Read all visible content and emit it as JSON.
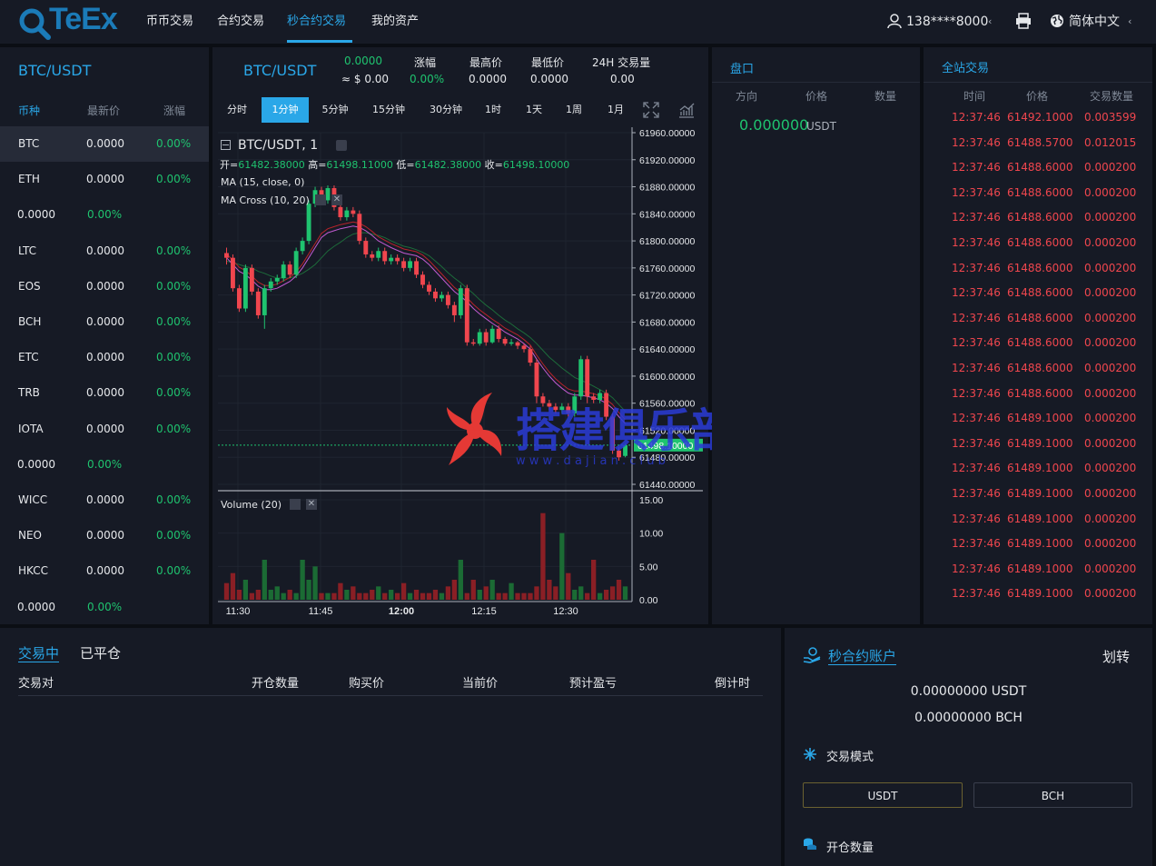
{
  "header": {
    "logo": "TeEx",
    "nav": [
      "币币交易",
      "合约交易",
      "秒合约交易",
      "我的资产"
    ],
    "active_nav": 2,
    "user": "138****8000",
    "language": "简体中文"
  },
  "market": {
    "title": "BTC/USDT",
    "columns": [
      "币种",
      "最新价",
      "涨幅"
    ],
    "rows": [
      {
        "coin": "BTC",
        "price": "0.0000",
        "change": "0.00%"
      },
      {
        "coin": "ETH",
        "price": "0.0000",
        "change": "0.00%"
      },
      {
        "coin": "",
        "price": "0.0000",
        "change": "0.00%"
      },
      {
        "coin": "LTC",
        "price": "0.0000",
        "change": "0.00%"
      },
      {
        "coin": "EOS",
        "price": "0.0000",
        "change": "0.00%"
      },
      {
        "coin": "BCH",
        "price": "0.0000",
        "change": "0.00%"
      },
      {
        "coin": "ETC",
        "price": "0.0000",
        "change": "0.00%"
      },
      {
        "coin": "TRB",
        "price": "0.0000",
        "change": "0.00%"
      },
      {
        "coin": "IOTA",
        "price": "0.0000",
        "change": "0.00%"
      },
      {
        "coin": "",
        "price": "0.0000",
        "change": "0.00%"
      },
      {
        "coin": "WICC",
        "price": "0.0000",
        "change": "0.00%"
      },
      {
        "coin": "NEO",
        "price": "0.0000",
        "change": "0.00%"
      },
      {
        "coin": "HKCC",
        "price": "0.0000",
        "change": "0.00%"
      },
      {
        "coin": "",
        "price": "0.0000",
        "change": "0.00%"
      }
    ]
  },
  "ticker": {
    "pair": "BTC/USDT",
    "last": "0.0000",
    "last_usd": "≈ $ 0.00",
    "change_label": "涨幅",
    "change": "0.00%",
    "high_label": "最高价",
    "high": "0.0000",
    "low_label": "最低价",
    "low": "0.0000",
    "vol_label": "24H 交易量",
    "vol": "0.00"
  },
  "timeframes": [
    "分时",
    "1分钟",
    "5分钟",
    "15分钟",
    "30分钟",
    "1时",
    "1天",
    "1周",
    "1月"
  ],
  "active_timeframe": 1,
  "chart_legend": {
    "symbol": "BTC/USDT, 1",
    "open_label": "开=",
    "open": "61482.38000",
    "high_label": "高=",
    "high": "61498.11000",
    "low_label": "低=",
    "low": "61482.38000",
    "close_label": "收=",
    "close": "61498.10000",
    "ma": "MA (15, close, 0)",
    "macross": "MA Cross (10, 20)",
    "volume": "Volume (20)"
  },
  "chart_data": {
    "type": "candlestick",
    "x_ticks": [
      "11:30",
      "11:45",
      "12:00",
      "12:15",
      "12:30"
    ],
    "price_ticks": [
      "61960.00000",
      "61920.00000",
      "61880.00000",
      "61840.00000",
      "61800.00000",
      "61760.00000",
      "61720.00000",
      "61680.00000",
      "61640.00000",
      "61600.00000",
      "61560.00000",
      "61520.00000",
      "61480.00000",
      "61440.00000"
    ],
    "ylim": [
      61440,
      61960
    ],
    "volume_ticks": [
      "15.00",
      "10.00",
      "5.00",
      "0.00"
    ],
    "volume_ylim": [
      0,
      15
    ],
    "last_price_label": "61498.10000",
    "candles": [
      [
        61782,
        61775,
        61790,
        61765
      ],
      [
        61775,
        61730,
        61780,
        61725
      ],
      [
        61730,
        61700,
        61735,
        61695
      ],
      [
        61700,
        61760,
        61765,
        61695
      ],
      [
        61760,
        61725,
        61765,
        61720
      ],
      [
        61725,
        61690,
        61730,
        61685
      ],
      [
        61690,
        61730,
        61735,
        61670
      ],
      [
        61730,
        61740,
        61745,
        61725
      ],
      [
        61740,
        61745,
        61750,
        61735
      ],
      [
        61745,
        61765,
        61770,
        61740
      ],
      [
        61765,
        61750,
        61770,
        61745
      ],
      [
        61750,
        61785,
        61790,
        61745
      ],
      [
        61785,
        61800,
        61805,
        61780
      ],
      [
        61800,
        61855,
        61860,
        61795
      ],
      [
        61855,
        61875,
        61880,
        61850
      ],
      [
        61875,
        61860,
        61880,
        61855
      ],
      [
        61860,
        61878,
        61882,
        61855
      ],
      [
        61878,
        61850,
        61882,
        61845
      ],
      [
        61850,
        61835,
        61855,
        61830
      ],
      [
        61835,
        61845,
        61850,
        61830
      ],
      [
        61845,
        61840,
        61850,
        61835
      ],
      [
        61840,
        61800,
        61845,
        61795
      ],
      [
        61800,
        61780,
        61805,
        61775
      ],
      [
        61780,
        61775,
        61785,
        61770
      ],
      [
        61775,
        61785,
        61790,
        61770
      ],
      [
        61785,
        61770,
        61790,
        61765
      ],
      [
        61770,
        61775,
        61780,
        61765
      ],
      [
        61775,
        61770,
        61780,
        61765
      ],
      [
        61770,
        61760,
        61775,
        61755
      ],
      [
        61760,
        61770,
        61775,
        61755
      ],
      [
        61770,
        61750,
        61775,
        61745
      ],
      [
        61750,
        61735,
        61755,
        61730
      ],
      [
        61735,
        61725,
        61740,
        61720
      ],
      [
        61725,
        61715,
        61730,
        61710
      ],
      [
        61715,
        61720,
        61725,
        61710
      ],
      [
        61720,
        61705,
        61725,
        61700
      ],
      [
        61705,
        61690,
        61710,
        61680
      ],
      [
        61690,
        61730,
        61735,
        61685
      ],
      [
        61730,
        61650,
        61735,
        61645
      ],
      [
        61650,
        61648,
        61655,
        61645
      ],
      [
        61648,
        61665,
        61670,
        61645
      ],
      [
        61665,
        61650,
        61670,
        61645
      ],
      [
        61650,
        61670,
        61675,
        61648
      ],
      [
        61670,
        61655,
        61675,
        61650
      ],
      [
        61655,
        61648,
        61658,
        61645
      ],
      [
        61648,
        61650,
        61655,
        61645
      ],
      [
        61650,
        61645,
        61652,
        61640
      ],
      [
        61645,
        61640,
        61648,
        61635
      ],
      [
        61640,
        61620,
        61645,
        61615
      ],
      [
        61620,
        61570,
        61625,
        61560
      ],
      [
        61570,
        61560,
        61575,
        61555
      ],
      [
        61560,
        61555,
        61565,
        61550
      ],
      [
        61555,
        61550,
        61560,
        61545
      ],
      [
        61550,
        61555,
        61560,
        61545
      ],
      [
        61555,
        61545,
        61560,
        61540
      ],
      [
        61545,
        61570,
        61575,
        61540
      ],
      [
        61570,
        61625,
        61630,
        61565
      ],
      [
        61625,
        61570,
        61630,
        61560
      ],
      [
        61570,
        61565,
        61575,
        61560
      ],
      [
        61565,
        61575,
        61580,
        61560
      ],
      [
        61575,
        61540,
        61580,
        61535
      ],
      [
        61540,
        61490,
        61545,
        61485
      ],
      [
        61490,
        61480,
        61495,
        61475
      ],
      [
        61482,
        61498,
        61500,
        61480
      ]
    ],
    "volumes": [
      2.5,
      4,
      1.5,
      3,
      1,
      1.5,
      6,
      1.5,
      2,
      1,
      1.5,
      1,
      6,
      3,
      5,
      1,
      1,
      1,
      2.5,
      1.5,
      2,
      1,
      1,
      1.5,
      2,
      1,
      1.5,
      1,
      2.5,
      1,
      1.5,
      1,
      1,
      1.5,
      1,
      2,
      3,
      6,
      1,
      3,
      1.5,
      2,
      3,
      1,
      1,
      2.5,
      1,
      1,
      1,
      2,
      13,
      3,
      2,
      10,
      4,
      1.5,
      2,
      1,
      6,
      1,
      1.5,
      2,
      3,
      2
    ],
    "ma15": [
      61775,
      61765,
      61755,
      61750,
      61742,
      61733,
      61728,
      61728,
      61730,
      61735,
      61740,
      61748,
      61760,
      61775,
      61790,
      61805,
      61812,
      61815,
      61818,
      61820,
      61822,
      61820,
      61815,
      61808,
      61800,
      61795,
      61790,
      61786,
      61782,
      61780,
      61778,
      61773,
      61765,
      61755,
      61745,
      61735,
      61725,
      61718,
      61710,
      61700,
      61692,
      61685,
      61678,
      61672,
      61665,
      61660,
      61655,
      61648,
      61640,
      61625,
      61612,
      61600,
      61590,
      61582,
      61575,
      61572,
      61572,
      61570,
      61568,
      61565,
      61560,
      61552,
      61540,
      61530
    ],
    "ma20": [
      61770,
      61768,
      61765,
      61762,
      61760,
      61755,
      61752,
      61748,
      61745,
      61745,
      61745,
      61748,
      61752,
      61758,
      61765,
      61775,
      61785,
      61792,
      61798,
      61805,
      61810,
      61812,
      61812,
      61810,
      61808,
      61805,
      61800,
      61796,
      61792,
      61790,
      61787,
      61783,
      61778,
      61770,
      61762,
      61753,
      61745,
      61738,
      61730,
      61722,
      61713,
      61705,
      61698,
      61690,
      61683,
      61677,
      61670,
      61664,
      61657,
      61648,
      61638,
      61628,
      61620,
      61612,
      61605,
      61598,
      61594,
      61590,
      61585,
      61580,
      61575,
      61568,
      61558,
      61548
    ]
  },
  "orderbook": {
    "title": "盘口",
    "columns": [
      "方向",
      "价格",
      "数量"
    ],
    "value": "0.000000",
    "unit": "USDT"
  },
  "trades": {
    "title": "全站交易",
    "columns": [
      "时间",
      "价格",
      "交易数量"
    ],
    "rows": [
      [
        "12:37:46",
        "61492.1000",
        "0.003599"
      ],
      [
        "12:37:46",
        "61488.5700",
        "0.012015"
      ],
      [
        "12:37:46",
        "61488.6000",
        "0.000200"
      ],
      [
        "12:37:46",
        "61488.6000",
        "0.000200"
      ],
      [
        "12:37:46",
        "61488.6000",
        "0.000200"
      ],
      [
        "12:37:46",
        "61488.6000",
        "0.000200"
      ],
      [
        "12:37:46",
        "61488.6000",
        "0.000200"
      ],
      [
        "12:37:46",
        "61488.6000",
        "0.000200"
      ],
      [
        "12:37:46",
        "61488.6000",
        "0.000200"
      ],
      [
        "12:37:46",
        "61488.6000",
        "0.000200"
      ],
      [
        "12:37:46",
        "61488.6000",
        "0.000200"
      ],
      [
        "12:37:46",
        "61488.6000",
        "0.000200"
      ],
      [
        "12:37:46",
        "61489.1000",
        "0.000200"
      ],
      [
        "12:37:46",
        "61489.1000",
        "0.000200"
      ],
      [
        "12:37:46",
        "61489.1000",
        "0.000200"
      ],
      [
        "12:37:46",
        "61489.1000",
        "0.000200"
      ],
      [
        "12:37:46",
        "61489.1000",
        "0.000200"
      ],
      [
        "12:37:46",
        "61489.1000",
        "0.000200"
      ],
      [
        "12:37:46",
        "61489.1000",
        "0.000200"
      ],
      [
        "12:37:46",
        "61489.1000",
        "0.000200"
      ]
    ]
  },
  "positions": {
    "tabs": [
      "交易中",
      "已平仓"
    ],
    "columns": [
      "交易对",
      "开仓数量",
      "购买价",
      "当前价",
      "预计盈亏",
      "倒计时"
    ]
  },
  "account": {
    "title": "秒合约账户",
    "transfer": "划转",
    "usdt_balance": "0.00000000 USDT",
    "bch_balance": "0.00000000 BCH",
    "mode_label": "交易模式",
    "modes": [
      "USDT",
      "BCH"
    ],
    "qty_label": "开仓数量"
  },
  "watermark": {
    "text": "搭建俱乐部",
    "url": "w w w . d a j i a n . c l u b"
  },
  "colors": {
    "accent": "#2aa7e8",
    "up": "#1fc36f",
    "down": "#f0464e",
    "panel": "#161a25",
    "bg": "#0b0e14"
  }
}
